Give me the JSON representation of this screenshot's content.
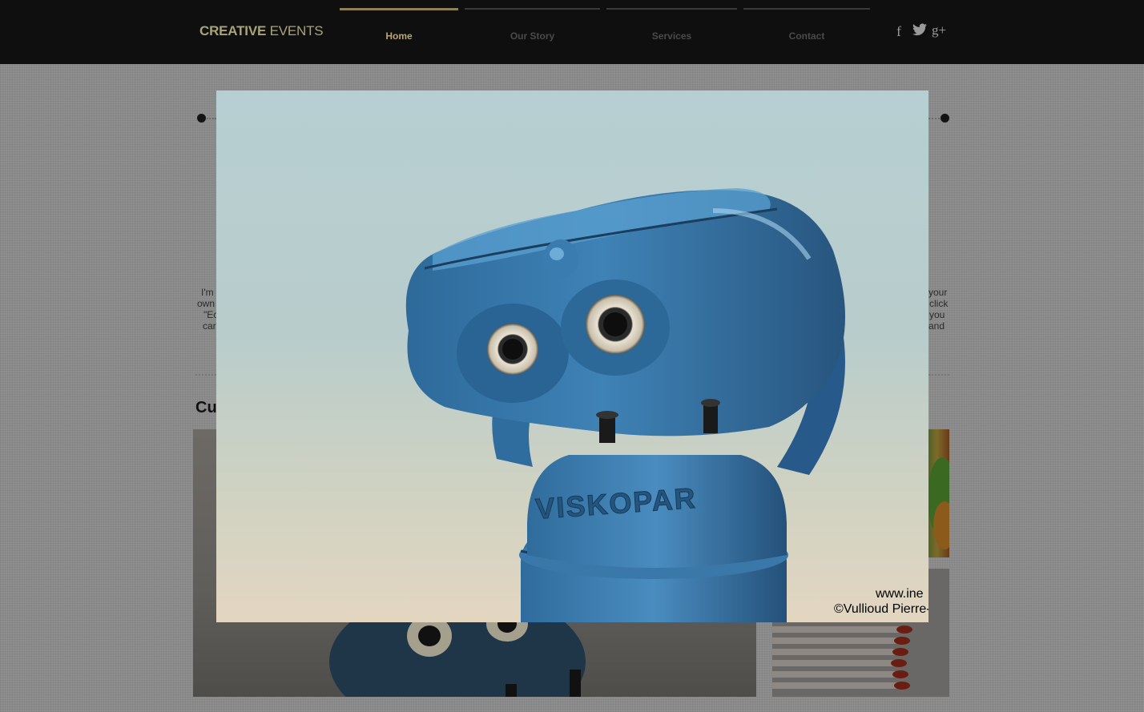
{
  "header": {
    "logo_bold": "CREATIVE",
    "logo_rest": " EVENTS",
    "nav": [
      {
        "label": "Home",
        "active": true
      },
      {
        "label": "Our Story",
        "active": false
      },
      {
        "label": "Services",
        "active": false
      },
      {
        "label": "Contact",
        "active": false
      }
    ],
    "social": {
      "facebook": "f",
      "twitter": "t",
      "googleplus": "g+"
    }
  },
  "background_page": {
    "text_left": [
      "I'm",
      "own",
      "\"Ec",
      "car"
    ],
    "text_right": [
      "your",
      "click",
      "you",
      "and"
    ],
    "section_heading": "Cu"
  },
  "lightbox": {
    "device_label": "VISKOPAR",
    "watermark_line1": "www.ine",
    "watermark_line2": "©Vullioud Pierre-"
  },
  "colors": {
    "topbar": "#0f0f0f",
    "active_nav": "#b9a673",
    "logo": "#a8a478",
    "device_blue": "#3f7fb0"
  }
}
